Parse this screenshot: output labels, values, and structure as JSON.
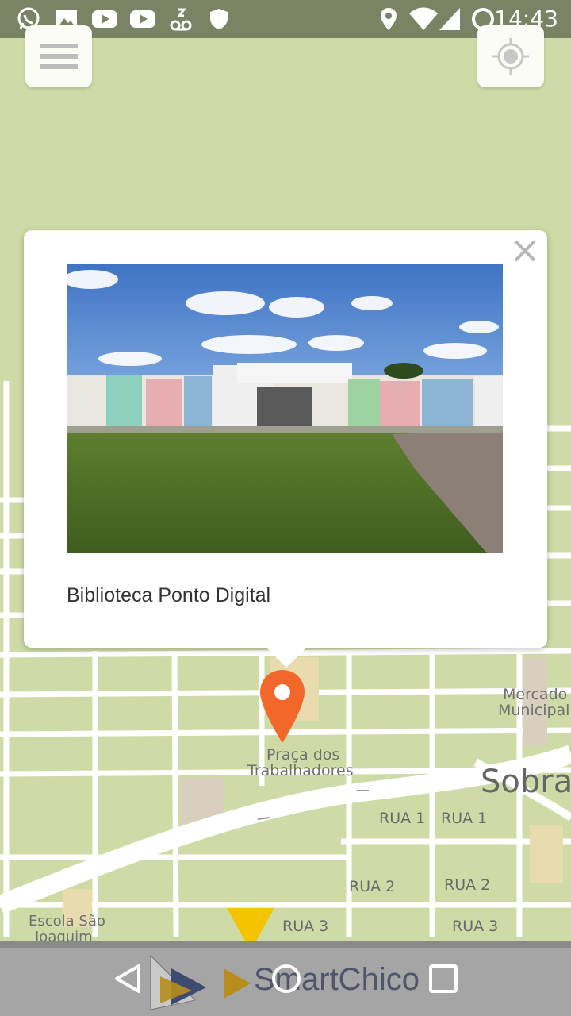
{
  "status_bar": {
    "time": "14:43",
    "left_icons": [
      "whatsapp-icon",
      "image-icon",
      "youtube-icon",
      "youtube-icon",
      "voicemail-icon",
      "shield-icon"
    ],
    "right_icons": [
      "location-icon",
      "wifi-icon",
      "signal-icon",
      "battery-icon"
    ]
  },
  "map": {
    "labels": {
      "praca_line1": "Praça dos",
      "praca_line2": "Trabalhadores",
      "mercado_line1": "Mercado",
      "mercado_line2": "Municipal",
      "sobral": "Sobra",
      "escola_line1": "Escola São",
      "escola_line2": "Joaquim",
      "rua1_a": "RUA 1",
      "rua1_b": "RUA 1",
      "rua2_a": "RUA 2",
      "rua2_b": "RUA 2",
      "rua3_a": "RUA 3",
      "rua3_b": "RUA 3"
    },
    "marker_color": "#f2672a"
  },
  "popup": {
    "title": "Biblioteca Ponto Digital"
  },
  "bottom_bar": {
    "brand": "SmartChico"
  }
}
